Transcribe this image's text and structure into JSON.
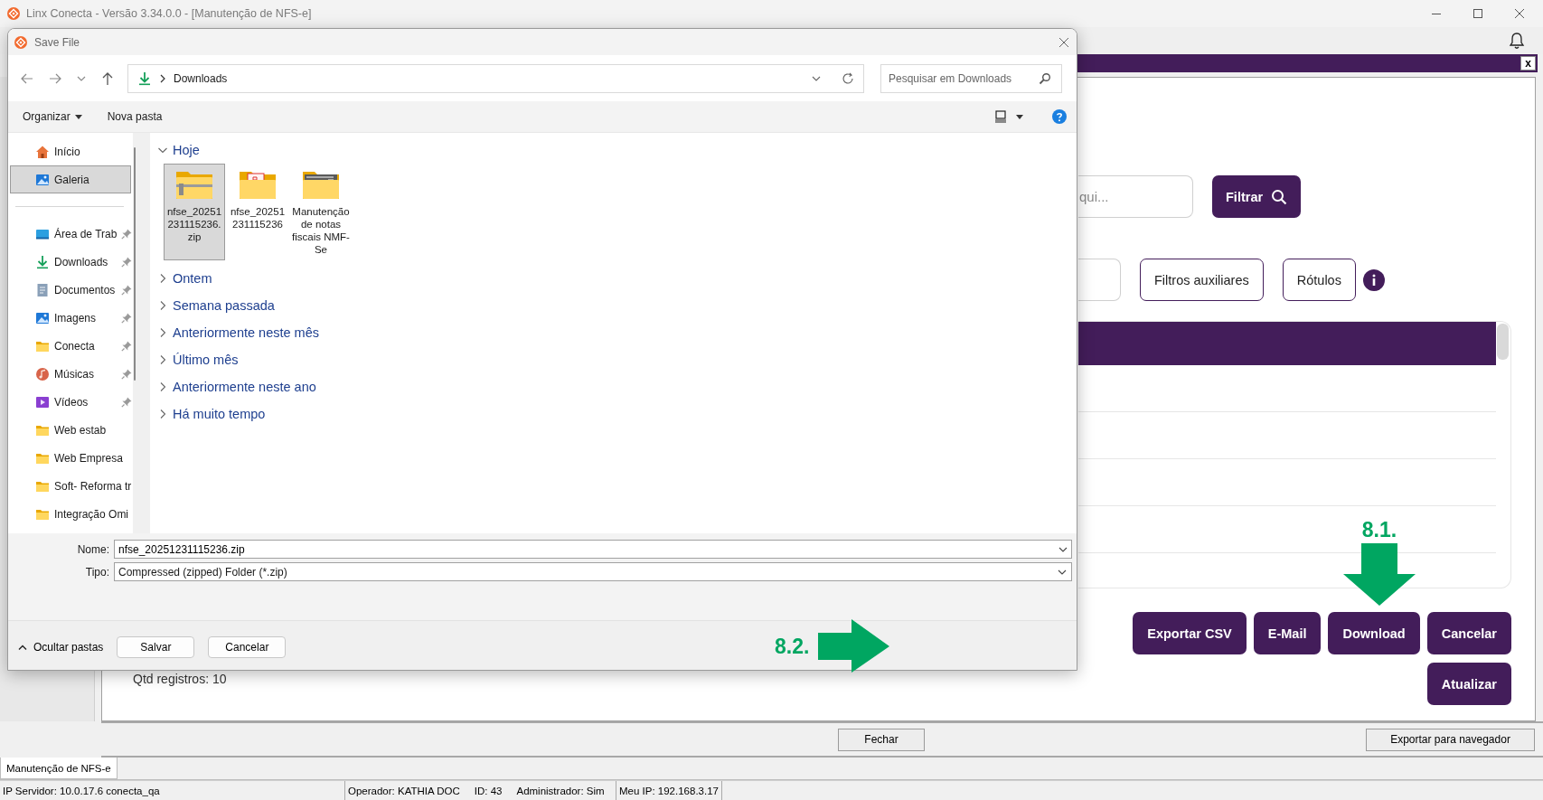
{
  "app": {
    "title": "Linx Conecta - Versão 3.34.0.0 - [Manutenção de NFS-e]",
    "close_label": "x",
    "search": {
      "placeholder": "qui..."
    },
    "filter_button": "Filtrar",
    "option_buttons": [
      "Filtros auxiliares",
      "Rótulos"
    ],
    "record_count": "Qtd registros: 10",
    "actions": [
      [
        "Exportar CSV",
        "E-Mail",
        "Download",
        "Cancelar"
      ],
      [
        "Atualizar"
      ]
    ],
    "footer_buttons": [
      "Fechar",
      "Exportar para navegador"
    ],
    "tabs": [
      {
        "label": "Manutenção de NFS-e",
        "selected": true
      }
    ],
    "status_bar": [
      [
        "IP Servidor: 10.0.17.6 conecta_qa"
      ],
      [
        "Operador: KATHIA DOC",
        "ID: 43",
        "Administrador: Sim"
      ],
      [
        "Meu IP: 192.168.3.17"
      ]
    ]
  },
  "dialog": {
    "title": "Save File",
    "address": "Downloads",
    "search": {
      "placeholder": "Pesquisar em Downloads"
    },
    "toolbar": [
      {
        "label": "Organizar",
        "kind": "menu"
      },
      {
        "label": "Nova pasta",
        "kind": "button"
      }
    ],
    "sidebar": [
      [
        {
          "label": "Início",
          "kind": "home",
          "pinned": false,
          "selected": false
        },
        {
          "label": "Galeria",
          "kind": "gallery",
          "pinned": false,
          "selected": true
        }
      ],
      [
        {
          "label": "Área de Trab",
          "kind": "desktop",
          "pinned": true,
          "selected": false
        },
        {
          "label": "Downloads",
          "kind": "download",
          "pinned": true,
          "selected": false
        },
        {
          "label": "Documentos",
          "kind": "documents",
          "pinned": true,
          "selected": false
        },
        {
          "label": "Imagens",
          "kind": "images",
          "pinned": true,
          "selected": false
        },
        {
          "label": "Conecta",
          "kind": "folder",
          "pinned": true,
          "selected": false
        },
        {
          "label": "Músicas",
          "kind": "music",
          "pinned": true,
          "selected": false
        },
        {
          "label": "Vídeos",
          "kind": "video",
          "pinned": true,
          "selected": false
        },
        {
          "label": "Web estab",
          "kind": "folder",
          "pinned": false,
          "selected": false
        },
        {
          "label": "Web Empresa",
          "kind": "folder",
          "pinned": false,
          "selected": false
        },
        {
          "label": "Soft- Reforma tr",
          "kind": "folder",
          "pinned": false,
          "selected": false
        },
        {
          "label": "Integração Omi",
          "kind": "folder",
          "pinned": false,
          "selected": false
        }
      ]
    ],
    "groups": [
      {
        "label": "Hoje",
        "expanded": true,
        "files": [
          {
            "name": "nfse_20251231115236.zip",
            "kind": "zip",
            "selected": true
          },
          {
            "name": "nfse_20251231115236",
            "kind": "pdf_folder",
            "selected": false
          },
          {
            "name": "Manutenção de notas fiscais NMF-Se",
            "kind": "doc_folder",
            "selected": false
          }
        ]
      },
      {
        "label": "Ontem",
        "expanded": false
      },
      {
        "label": "Semana passada",
        "expanded": false
      },
      {
        "label": "Anteriormente neste mês",
        "expanded": false
      },
      {
        "label": "Último mês",
        "expanded": false
      },
      {
        "label": "Anteriormente neste ano",
        "expanded": false
      },
      {
        "label": "Há muito tempo",
        "expanded": false
      }
    ],
    "file_name": {
      "label": "Nome:",
      "value": "nfse_20251231115236.zip"
    },
    "file_type": {
      "label": "Tipo:",
      "value": "Compressed (zipped) Folder (*.zip)"
    },
    "hide_folders": "Ocultar pastas",
    "buttons": [
      "Salvar",
      "Cancelar"
    ]
  },
  "annotations": [
    {
      "label": "8.1.",
      "kind": "down"
    },
    {
      "label": "8.2.",
      "kind": "right"
    }
  ]
}
